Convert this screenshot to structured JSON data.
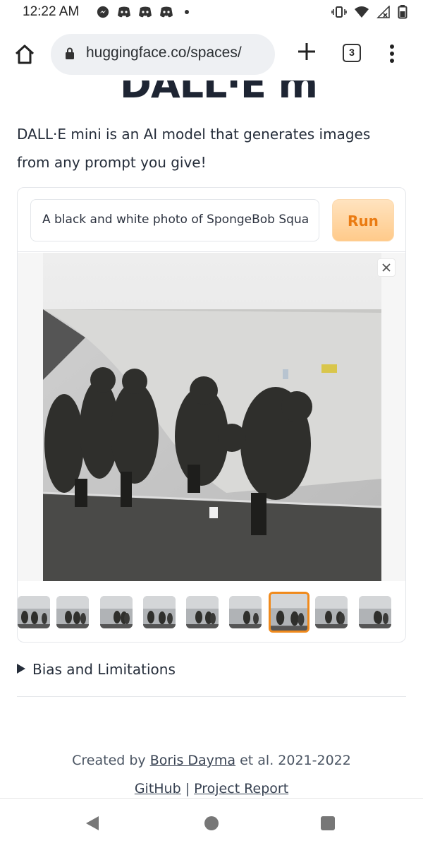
{
  "status_bar": {
    "time": "12:22 AM",
    "left_icons": [
      "messenger-icon",
      "discord-icon",
      "discord-icon",
      "discord-icon",
      "notification-dot-icon"
    ],
    "right_icons": [
      "vibrate-icon",
      "wifi-icon",
      "signal-icon",
      "battery-icon"
    ]
  },
  "browser": {
    "url": "huggingface.co/spaces/",
    "tab_count": "3",
    "icons": [
      "home-icon",
      "lock-icon",
      "plus-icon",
      "tabs-icon",
      "kebab-menu-icon"
    ]
  },
  "page": {
    "title": "DALL·E mini",
    "description": "DALL·E mini is an AI model that generates images from any prompt you give!",
    "prompt_value": "A black and white photo of SpongeBob Squa",
    "run_label": "Run",
    "gallery": {
      "thumbnail_count": 9,
      "selected_index": 6
    },
    "bias_label": "Bias and Limitations",
    "footer": {
      "created_prefix": "Created by ",
      "author": "Boris Dayma",
      "created_suffix": " et al. 2021-2022",
      "github": "GitHub",
      "separator": " | ",
      "report": "Project Report"
    }
  },
  "colors": {
    "accent": "#ea7b12",
    "selected_border": "#f08a1c"
  }
}
